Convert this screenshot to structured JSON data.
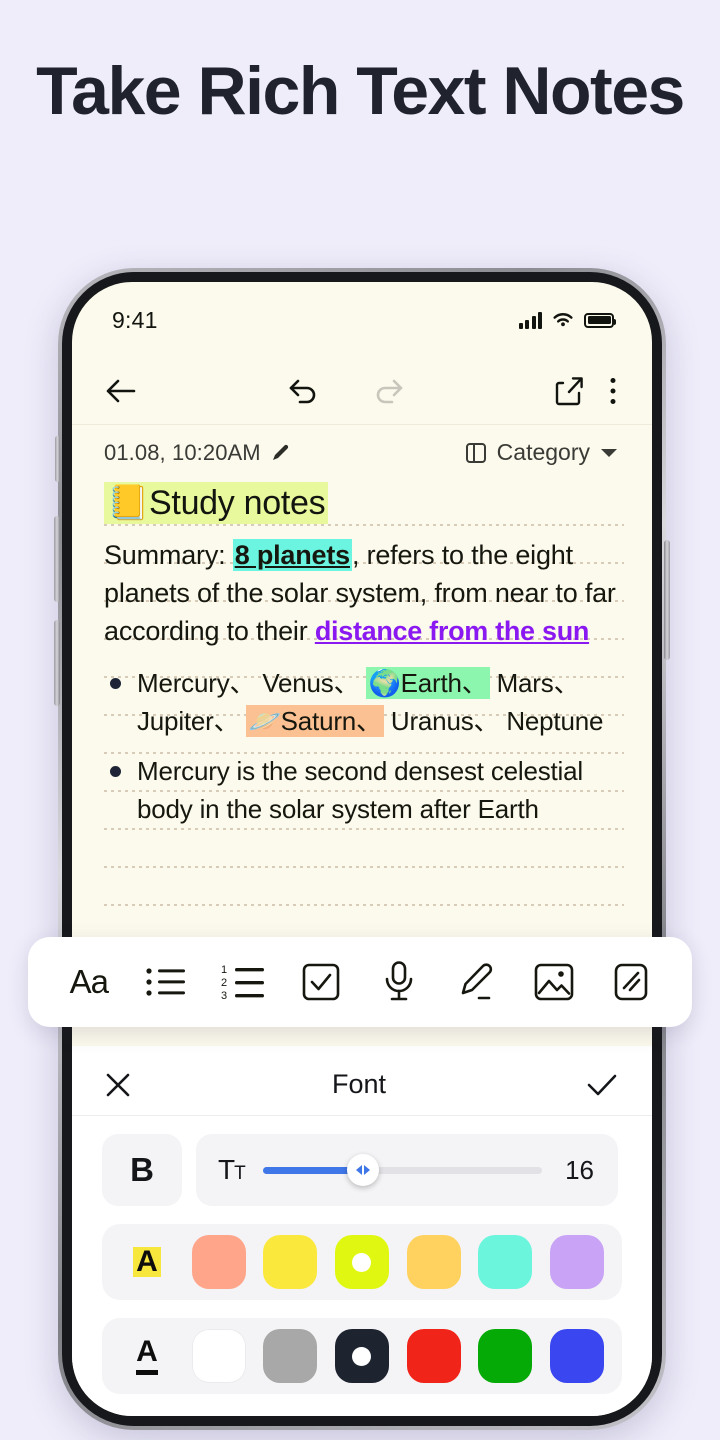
{
  "headline": "Take Rich Text Notes",
  "theme": {
    "page_bg": "#EFEDFA",
    "headline_color": "#20232E",
    "note_bg": "#FCFAEC",
    "rule_color": "#D8CBB8",
    "accent_blue": "#3F76E8"
  },
  "status_bar": {
    "time": "9:41",
    "signal_icon": "cellular-signal-icon",
    "wifi_icon": "wifi-icon",
    "battery_icon": "battery-full-icon"
  },
  "note_toolbar": {
    "back_icon": "back-arrow-icon",
    "undo_icon": "undo-icon",
    "redo_icon": "redo-icon",
    "redo_disabled": true,
    "share_icon": "share-icon",
    "more_icon": "more-vertical-icon"
  },
  "meta": {
    "date": "01.08, 10:20AM",
    "edit_icon": "pencil-icon",
    "category_icon": "category-panel-icon",
    "category_label": "Category",
    "dropdown_icon": "chevron-down-icon"
  },
  "note": {
    "title_emoji": "📒",
    "title": "Study notes",
    "title_highlight": "#E8F89C",
    "summary": {
      "before": "Summary: ",
      "highlight_text": "8 planets",
      "highlight_color": "#6BF5E0",
      "middle": ", refers to the eight planets of the solar system, from near to far according to their ",
      "link_text": "distance from the sun",
      "link_color": "#8A18F0"
    },
    "bullets": [
      {
        "segments": [
          {
            "text": "Mercury、 Venus、 "
          },
          {
            "text": "🌍Earth、",
            "highlight": "#8CF5AE"
          },
          {
            "text": " Mars、 Jupiter、 "
          },
          {
            "text": "🪐Saturn、",
            "highlight": "#FBC193"
          },
          {
            "text": " Uranus、 Neptune"
          }
        ]
      },
      {
        "segments": [
          {
            "text": "Mercury is the second densest celestial body in the solar system after Earth"
          }
        ]
      }
    ]
  },
  "format_toolbar": {
    "items": [
      {
        "name": "font-style-button",
        "label": "Aa",
        "icon": "font-aa-icon"
      },
      {
        "name": "bullet-list-button",
        "label": "",
        "icon": "bullet-list-icon"
      },
      {
        "name": "numbered-list-button",
        "label": "",
        "icon": "numbered-list-icon"
      },
      {
        "name": "checkbox-button",
        "label": "",
        "icon": "checkbox-icon"
      },
      {
        "name": "voice-record-button",
        "label": "",
        "icon": "microphone-icon"
      },
      {
        "name": "draw-button",
        "label": "",
        "icon": "pen-icon"
      },
      {
        "name": "image-button",
        "label": "",
        "icon": "image-icon"
      },
      {
        "name": "attachment-button",
        "label": "",
        "icon": "scribble-card-icon"
      }
    ]
  },
  "font_panel": {
    "close_icon": "close-icon",
    "title": "Font",
    "confirm_icon": "checkmark-icon",
    "bold_label": "B",
    "size_icon": "text-size-icon",
    "size_value": "16",
    "slider_percent": 36,
    "highlight_row": {
      "label_icon": "text-highlight-a-icon",
      "colors": [
        "#FFA58A",
        "#FAE83C",
        "#E0F811",
        "#FFD15E",
        "#6BF5DC",
        "#C9A3F5"
      ],
      "selected_index": 2
    },
    "text_color_row": {
      "label_icon": "text-color-a-icon",
      "colors": [
        "#FFFFFF",
        "#A8A8A8",
        "#1D2430",
        "#F02418",
        "#06AA06",
        "#3A46F0"
      ],
      "selected_index": 2
    }
  }
}
